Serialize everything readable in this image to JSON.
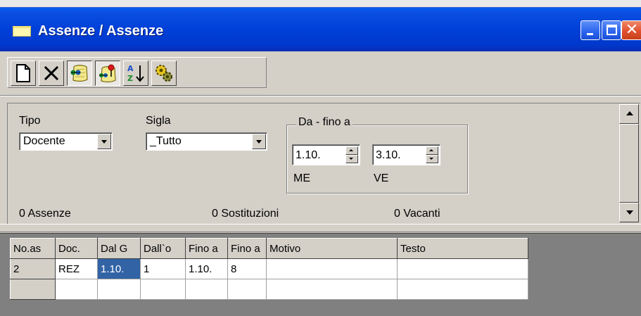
{
  "window": {
    "title": "Assenze / Assenze"
  },
  "toolbar": {
    "buttons": [
      {
        "name": "new-document-icon",
        "pressed": false
      },
      {
        "name": "delete-icon",
        "pressed": false
      },
      {
        "name": "map-substitution-icon",
        "pressed": true
      },
      {
        "name": "map-pin-icon",
        "pressed": true
      },
      {
        "name": "sort-az-icon",
        "pressed": false
      },
      {
        "name": "settings-gears-icon",
        "pressed": false
      }
    ]
  },
  "filters": {
    "tipo_label": "Tipo",
    "tipo_value": "Docente",
    "sigla_label": "Sigla",
    "sigla_value": "_Tutto",
    "range_title": "Da - fino a",
    "from_value": "1.10.",
    "to_value": "3.10.",
    "from_day": "ME",
    "to_day": "VE"
  },
  "counts": {
    "assenze": "0 Assenze",
    "sostituzioni": "0 Sostituzioni",
    "vacanti": "0 Vacanti"
  },
  "grid": {
    "headers": [
      "No.as",
      "Doc.",
      "Dal G",
      "Dall`o",
      "Fino a",
      "Fino a",
      "Motivo",
      "Testo"
    ],
    "rows": [
      [
        "2",
        "REZ",
        "1.10.",
        "1",
        "1.10.",
        "8",
        "",
        ""
      ],
      [
        "",
        "",
        "",
        "",
        "",
        "",
        "",
        ""
      ]
    ]
  },
  "colors": {
    "titlebar": "#0040d8",
    "selected_cell": "#3163a5",
    "face": "#d4d0c8"
  }
}
